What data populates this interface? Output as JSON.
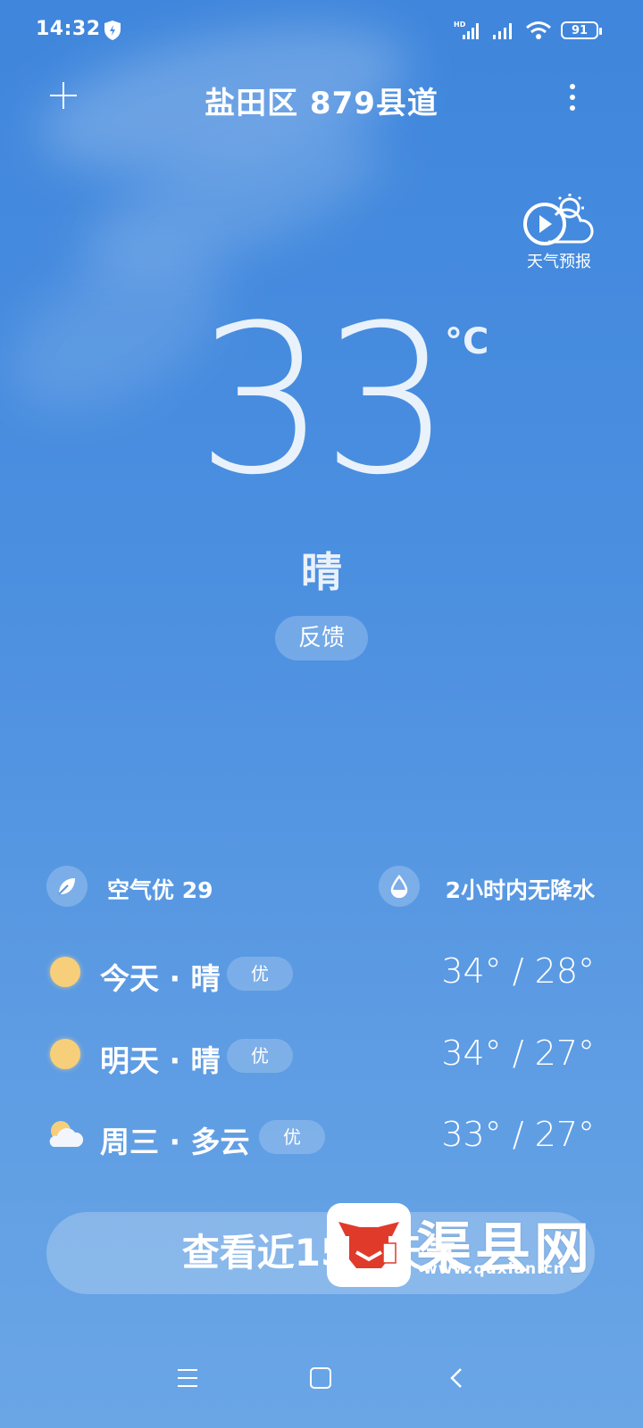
{
  "status_bar": {
    "time": "14:32",
    "battery": "91",
    "network_label": "HD"
  },
  "header": {
    "title": "盐田区 879县道",
    "add_icon": "plus-icon",
    "menu_icon": "more-vertical-icon"
  },
  "forecast_video": {
    "label": "天气预报",
    "icon": "play-cloud-sun-icon"
  },
  "current": {
    "temperature": "33",
    "unit": "°C",
    "condition": "晴",
    "feedback_label": "反馈"
  },
  "air": {
    "label": "空气优 29",
    "icon": "leaf-icon"
  },
  "precip": {
    "label": "2小时内无降水",
    "icon": "water-drop-icon"
  },
  "days": [
    {
      "label": "今天 · 晴",
      "badge": "优",
      "range": "34° / 28°",
      "icon": "sun-icon"
    },
    {
      "label": "明天 · 晴",
      "badge": "优",
      "range": "34° / 27°",
      "icon": "sun-icon"
    },
    {
      "label": "周三 · 多云",
      "badge": "优",
      "range": "33° / 27°",
      "icon": "partly-cloudy-icon"
    }
  ],
  "cta": {
    "label": "查看近15日天气"
  },
  "watermark": {
    "name": "渠县网",
    "url": "www.quxian.cn"
  },
  "colors": {
    "sky_top": "#3f86dc",
    "sky_bottom": "#6aa6e6",
    "sun": "#f7cf7a",
    "logo_red": "#e03a2a"
  }
}
